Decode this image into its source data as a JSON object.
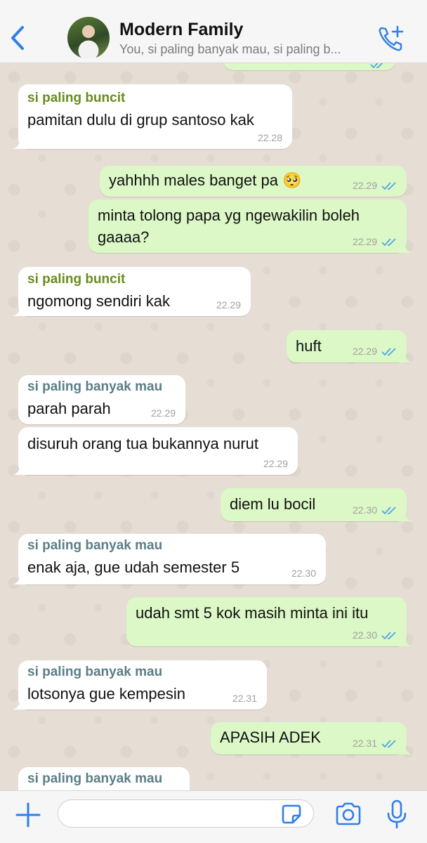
{
  "header": {
    "title": "Modern Family",
    "subtitle": "You, si paling banyak mau, si paling b...",
    "back_icon": "chevron-left-icon",
    "call_icon": "add-call-icon",
    "accent_color": "#2f7fe6"
  },
  "messages": [
    {
      "direction": "in",
      "sender": "si paling buncit",
      "text": "pamitan dulu di grup santoso kak",
      "time": "22.28"
    },
    {
      "direction": "out",
      "text": "yahhhh males banget pa 🥺",
      "time": "22.29",
      "status": "read"
    },
    {
      "direction": "out",
      "text": "minta tolong papa yg ngewakilin boleh gaaaa?",
      "time": "22.29",
      "status": "read"
    },
    {
      "direction": "in",
      "sender": "si paling buncit",
      "text": "ngomong sendiri kak",
      "time": "22.29"
    },
    {
      "direction": "out",
      "text": "huft",
      "time": "22.29",
      "status": "read"
    },
    {
      "direction": "in",
      "sender": "si paling banyak mau",
      "text": "parah parah",
      "time": "22.29"
    },
    {
      "direction": "in",
      "text": "disuruh orang tua bukannya nurut",
      "time": "22.29"
    },
    {
      "direction": "out",
      "text": "diem lu bocil",
      "time": "22.30",
      "status": "read"
    },
    {
      "direction": "in",
      "sender": "si paling banyak mau",
      "text": "enak aja, gue udah semester 5",
      "time": "22.30"
    },
    {
      "direction": "out",
      "text": "udah smt 5 kok masih minta ini itu",
      "time": "22.30",
      "status": "read"
    },
    {
      "direction": "in",
      "sender": "si paling banyak mau",
      "text": "lotsonya gue kempesin",
      "time": "22.31"
    },
    {
      "direction": "out",
      "text": "APASIH ADEK",
      "time": "22.31",
      "status": "read"
    },
    {
      "direction": "in",
      "sender": "si paling banyak mau",
      "text": "",
      "time": ""
    }
  ],
  "composer": {
    "input_value": "",
    "plus_icon": "plus-icon",
    "sticker_icon": "sticker-icon",
    "camera_icon": "camera-icon",
    "mic_icon": "microphone-icon"
  },
  "colors": {
    "incoming_bubble": "#ffffff",
    "outgoing_bubble": "#dcf8c6",
    "sender_buncit": "#6a8c1e",
    "sender_banyak_mau": "#5b7e86",
    "read_ticks": "#4fa6e6"
  }
}
